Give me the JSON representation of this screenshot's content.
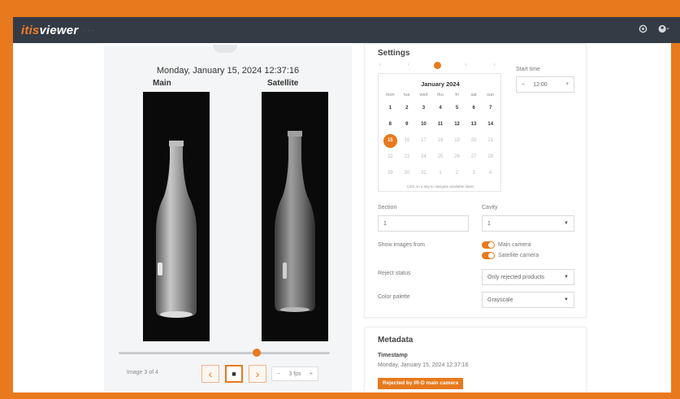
{
  "app": {
    "brand": "itis",
    "name": "viewer",
    "subtitle": "· · ·"
  },
  "topbar": {
    "icons": [
      "settings-icon",
      "user-icon"
    ]
  },
  "viewer": {
    "timestamp": "Monday, January 15, 2024 12:37:16",
    "main_label": "Main",
    "satellite_label": "Satellite",
    "slider_position": 0.66,
    "page_label": "Image 3 of 4",
    "prev": "‹",
    "play": "■",
    "next": "›",
    "fps_value": "3 fps"
  },
  "settings": {
    "title": "Settings",
    "steps": [
      "‹",
      "‹",
      "",
      "›",
      "›"
    ],
    "calendar": {
      "month": "January 2024",
      "weekdays": [
        "mon",
        "tue",
        "wed",
        "thu",
        "fri",
        "sat",
        "sun"
      ],
      "days": [
        "1",
        "2",
        "3",
        "4",
        "5",
        "6",
        "7",
        "8",
        "9",
        "10",
        "11",
        "12",
        "13",
        "14",
        "15",
        "16",
        "17",
        "18",
        "19",
        "20",
        "21",
        "22",
        "23",
        "24",
        "25",
        "26",
        "27",
        "28",
        "29",
        "30",
        "31",
        "1",
        "2",
        "3",
        "4"
      ],
      "selected": "15",
      "footer": "Click on a day to navigate available dates"
    },
    "start_time_label": "Start time",
    "start_time_value": "12:00",
    "section_label": "Section",
    "section_value": "1",
    "cavity_label": "Cavity",
    "cavity_value": "1",
    "show_images_label": "Show images from",
    "main_camera": "Main camera",
    "satellite_camera": "Satellite camera",
    "reject_status_label": "Reject status",
    "reject_status_value": "Only rejected products",
    "color_palette_label": "Color palette",
    "color_palette_value": "Grayscale"
  },
  "metadata": {
    "title": "Metadata",
    "timestamp_label": "Timestamp",
    "timestamp_value": "Monday, January 15, 2024 12:37:16",
    "badge": "Rejected by IR-D main camera"
  },
  "colors": {
    "accent": "#e8791c",
    "topbar": "#353b45",
    "frame": "#e8791c"
  }
}
